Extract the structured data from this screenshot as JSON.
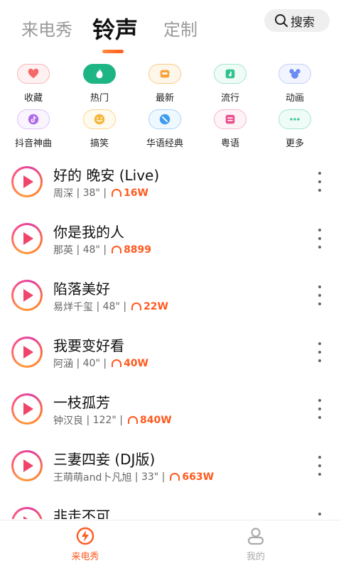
{
  "tabs": [
    {
      "label": "来电秀",
      "active": false
    },
    {
      "label": "铃声",
      "active": true
    },
    {
      "label": "定制",
      "active": false
    }
  ],
  "search": {
    "label": "搜索",
    "icon": "search-icon"
  },
  "categories": [
    {
      "label": "收藏",
      "icon": "heart-icon",
      "color": "#f36a6a"
    },
    {
      "label": "热门",
      "icon": "hot-icon",
      "color": "#1db584"
    },
    {
      "label": "最新",
      "icon": "new-icon",
      "color": "#f7a33b"
    },
    {
      "label": "流行",
      "icon": "music-note-icon",
      "color": "#2fc38d"
    },
    {
      "label": "动画",
      "icon": "mickey-icon",
      "color": "#6b8cf2"
    },
    {
      "label": "抖音神曲",
      "icon": "tiktok-icon",
      "color": "#b06be8"
    },
    {
      "label": "搞笑",
      "icon": "smile-icon",
      "color": "#f5b73b"
    },
    {
      "label": "华语经典",
      "icon": "globe-icon",
      "color": "#3f9cf0"
    },
    {
      "label": "粤语",
      "icon": "cantonese-icon",
      "color": "#e8508f"
    },
    {
      "label": "更多",
      "icon": "more-dots-icon",
      "color": "#2fc38d"
    }
  ],
  "songs": [
    {
      "title": "好的 晚安 (Live)",
      "artist": "周深",
      "duration": "38\"",
      "plays": "16W"
    },
    {
      "title": "你是我的人",
      "artist": "那英",
      "duration": "48\"",
      "plays": "8899"
    },
    {
      "title": "陷落美好",
      "artist": "易烊千玺",
      "duration": "48\"",
      "plays": "22W"
    },
    {
      "title": "我要变好看",
      "artist": "阿涵",
      "duration": "40\"",
      "plays": "40W"
    },
    {
      "title": "一枝孤芳",
      "artist": "钟汉良",
      "duration": "122\"",
      "plays": "840W"
    },
    {
      "title": "三妻四妾 (DJ版)",
      "artist": "王萌萌and卜凡旭",
      "duration": "33\"",
      "plays": "663W"
    },
    {
      "title": "非走不可",
      "artist": "",
      "duration": "",
      "plays": ""
    }
  ],
  "bottom_nav": [
    {
      "label": "来电秀",
      "icon": "lightning-icon",
      "active": true,
      "color": "#ff5a1f"
    },
    {
      "label": "我的",
      "icon": "user-icon",
      "active": false,
      "color": "#aaaaaa"
    }
  ]
}
